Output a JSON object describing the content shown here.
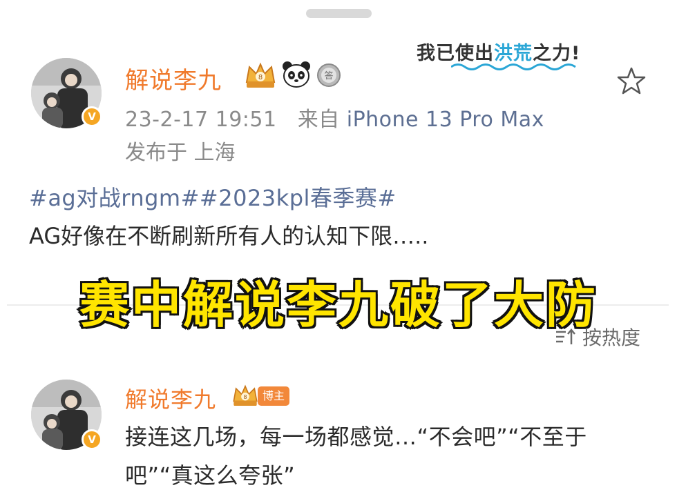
{
  "post": {
    "author": "解说李九",
    "timestamp": "23-2-17 19:51",
    "source_prefix": "来自",
    "device": "iPhone 13 Pro Max",
    "location": "发布于 上海",
    "hashtags": "#ag对战rngm##2023kpl春季赛#",
    "text": "AG好像在不断刷新所有人的认知下限…..",
    "slogan_start": "我已使出",
    "slogan_highlight": "洪荒",
    "slogan_end": "之力!",
    "badge_medal_char": "答",
    "crown_mark": "8"
  },
  "overlay_caption": "赛中解说李九破了大防",
  "comments_sort": {
    "label": "按热度"
  },
  "comment": {
    "author": "解说李九",
    "tag": "博主",
    "text": "接连这几场，每一场都感觉…“不会吧”“不至于吧”“真这么夸张”"
  },
  "icons": {
    "verified": "verified-badge-icon",
    "crown": "vip-crown-icon",
    "panda": "panda-icon",
    "medal": "medal-icon",
    "star": "star-outline-icon",
    "sort": "sort-icon"
  },
  "colors": {
    "name_orange": "#f07a2c",
    "link_blue": "#5a6e96",
    "caption_yellow": "#ffe500",
    "verify_gold": "#f5a623"
  }
}
